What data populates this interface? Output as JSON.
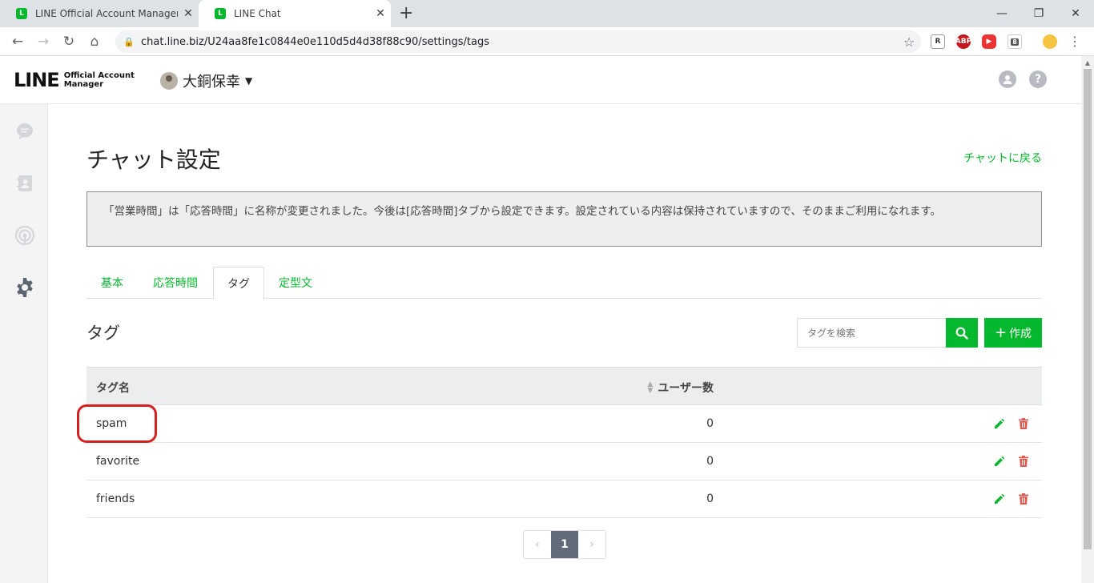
{
  "browser": {
    "tabs": [
      {
        "title": "LINE Official Account Manager",
        "active": false
      },
      {
        "title": "LINE Chat",
        "active": true
      }
    ],
    "url": "chat.line.biz/U24aa8fe1c0844e0e110d5d4d38f88c90/settings/tags",
    "favicon_letter": "L",
    "extensions": [
      "ABP",
      "8"
    ]
  },
  "header": {
    "logo_main": "LINE",
    "logo_sub_line1": "Official Account",
    "logo_sub_line2": "Manager",
    "account_name": "大銅保幸"
  },
  "page": {
    "title": "チャット設定",
    "back_link": "チャットに戻る",
    "notice": "「営業時間」は「応答時間」に名称が変更されました。今後は[応答時間]タブから設定できます。設定されている内容は保持されていますので、そのままご利用になれます。",
    "tabs": [
      {
        "label": "基本"
      },
      {
        "label": "応答時間"
      },
      {
        "label": "タグ"
      },
      {
        "label": "定型文"
      }
    ],
    "section_title": "タグ",
    "search_placeholder": "タグを検索",
    "create_label": "作成"
  },
  "table": {
    "headers": {
      "name": "タグ名",
      "users": "ユーザー数"
    },
    "rows": [
      {
        "name": "spam",
        "users": "0"
      },
      {
        "name": "favorite",
        "users": "0"
      },
      {
        "name": "friends",
        "users": "0"
      }
    ]
  },
  "pagination": {
    "current": "1"
  },
  "colors": {
    "accent": "#06b82d",
    "danger": "#e05a4f",
    "highlight": "#d62020"
  }
}
